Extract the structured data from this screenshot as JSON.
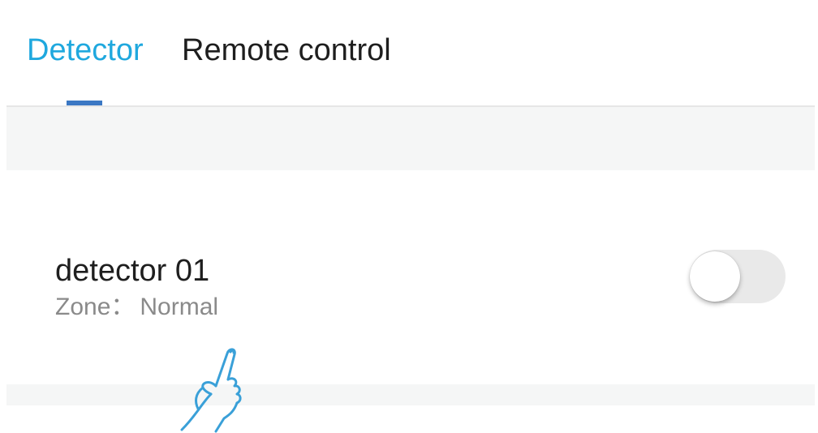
{
  "tabs": [
    {
      "label": "Detector",
      "active": true
    },
    {
      "label": "Remote control",
      "active": false
    }
  ],
  "colors": {
    "accent": "#1fa8de",
    "indicator": "#3b78c4",
    "hand_icon": "#3aa0d8",
    "toggle_off": "#e9e9e9"
  },
  "devices": [
    {
      "name": "detector 01",
      "zone_label": "Zone：",
      "zone_value": "Normal",
      "enabled": false
    }
  ],
  "icons": {
    "pointer": "hand-pointer-icon"
  }
}
